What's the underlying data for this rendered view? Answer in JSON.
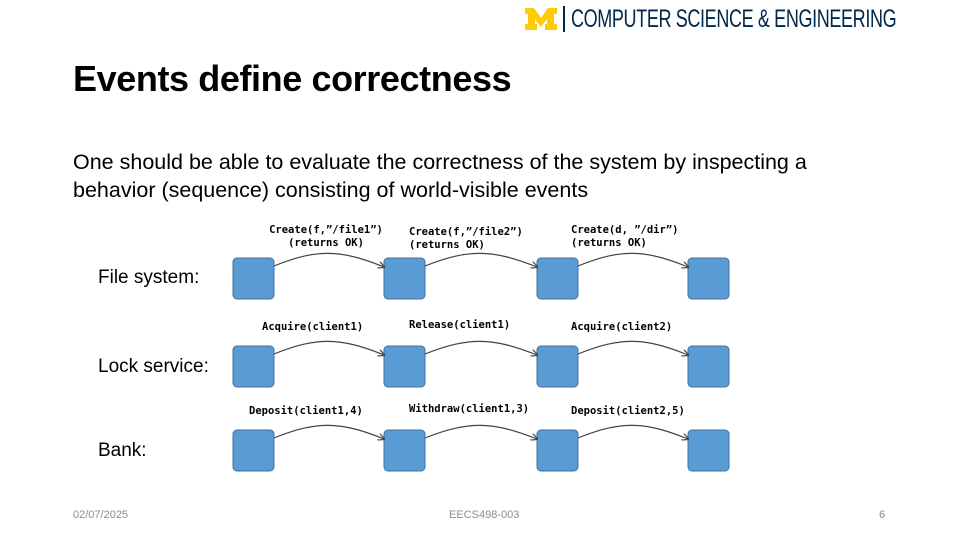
{
  "header": {
    "logo_text": "COMPUTER SCIENCE & ENGINEERING",
    "brand_blue": "#00274c",
    "brand_maize": "#ffcb05"
  },
  "slide": {
    "title": "Events define correctness",
    "body": "One should be able to evaluate the correctness of the system by inspecting a behavior (sequence) consisting of world-visible events"
  },
  "rows": [
    {
      "label": "File system:",
      "events": [
        {
          "line1": "Create(f,”/file1”)",
          "line2": "(returns OK)"
        },
        {
          "line1": "Create(f,”/file2”)",
          "line2": "(returns OK)"
        },
        {
          "line1": "Create(d, ”/dir”)",
          "line2": "(returns OK)"
        }
      ]
    },
    {
      "label": "Lock service:",
      "events": [
        {
          "line1": "Acquire(client1)"
        },
        {
          "line1": "Release(client1)"
        },
        {
          "line1": "Acquire(client2)"
        }
      ]
    },
    {
      "label": "Bank:",
      "events": [
        {
          "line1": "Deposit(client1,4)"
        },
        {
          "line1": "Withdraw(client1,3)"
        },
        {
          "line1": "Deposit(client2,5)"
        }
      ]
    }
  ],
  "state_box_color": "#5b9bd5",
  "footer": {
    "date": "02/07/2025",
    "course": "EECS498-003",
    "page": "6"
  }
}
